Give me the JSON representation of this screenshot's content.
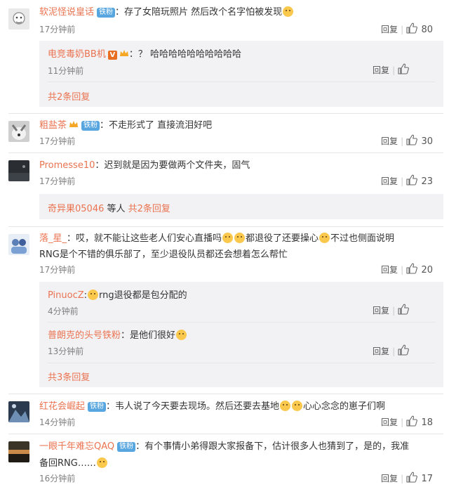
{
  "comments": [
    {
      "name": "软泥怪说皇话",
      "badge": "铁粉",
      "text": "：存了女陪玩照片 然后改个名字怕被发现",
      "time": "17分钟前",
      "reply": "回复",
      "likes": "80",
      "sub": [
        {
          "name": "电竞毒奶BB机",
          "vbadge": "V",
          "text": "：？ 哈哈哈哈哈哈哈哈哈哈",
          "time": "11分钟前",
          "reply": "回复",
          "likes": ""
        }
      ],
      "more": "共2条回复"
    },
    {
      "name": "粗盐茶",
      "badge": "铁粉",
      "text": "：不走形式了 直接流泪好吧",
      "time": "17分钟前",
      "reply": "回复",
      "likes": "30"
    },
    {
      "name": "Promesse10",
      "text": "：迟到就是因为要做两个文件夹，固气",
      "time": "17分钟前",
      "reply": "回复",
      "likes": "23",
      "more_prefix": "奇异果05046",
      "more_mid": " 等人 ",
      "more": "共2条回复"
    },
    {
      "name": "落_星_",
      "text_line1a": "：哎，就不能让这些老人们安心直播吗",
      "text_line1b": "都退役了还要操心",
      "text_line1c": "不过也侧面说明",
      "text_line2": "RNG是个不错的俱乐部了，至少退役队员都还会想着怎么帮忙",
      "time": "17分钟前",
      "reply": "回复",
      "likes": "20",
      "sub": [
        {
          "name": "PinuocZ",
          "text": "rng退役都是包分配的",
          "time": "4分钟前",
          "reply": "回复",
          "likes": ""
        },
        {
          "name": "普朗克的头号铁粉",
          "text": "：是他们很好",
          "time": "13分钟前",
          "reply": "回复",
          "likes": ""
        }
      ],
      "more": "共3条回复"
    },
    {
      "name": "红花会崛起",
      "badge": "铁粉",
      "text": "：韦人说了今天要去现场。然后还要去基地",
      "text_tail": "心心念念的崽子们啊",
      "time": "14分钟前",
      "reply": "回复",
      "likes": "18"
    },
    {
      "name": "一眼千年难忘QAQ",
      "badge": "铁粉",
      "text": "：有个事情小弟得跟大家报备下，估计很多人也猜到了，是的，我准",
      "text_line2": "备回RNG……",
      "time": "16分钟前",
      "reply": "回复",
      "likes": "17"
    }
  ],
  "colors": {
    "accent": "#eb7350",
    "badge": "#58a6e0",
    "subbox": "#f2f2f5"
  }
}
